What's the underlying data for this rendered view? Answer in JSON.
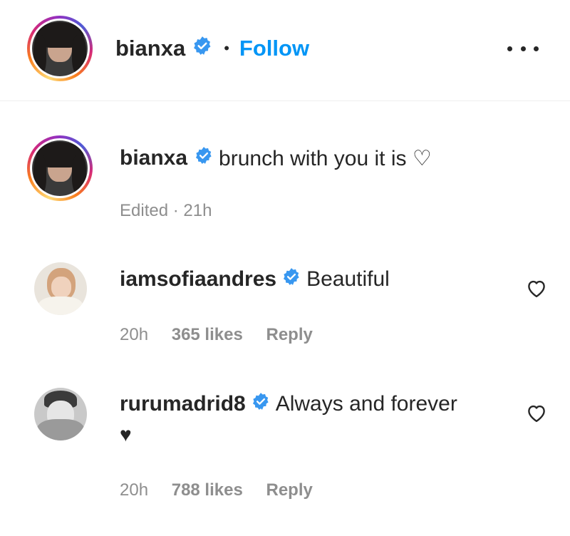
{
  "header": {
    "username": "bianxa",
    "separator": "•",
    "follow_label": "Follow",
    "more_label": "•••"
  },
  "caption": {
    "username": "bianxa",
    "text": "brunch with you it is ♡",
    "meta": "Edited · 21h"
  },
  "comments": [
    {
      "username": "iamsofiaandres",
      "text": "Beautiful",
      "time": "20h",
      "likes": "365 likes",
      "reply": "Reply"
    },
    {
      "username": "rurumadrid8",
      "text": "Always and forever",
      "text_line2": "♥",
      "time": "20h",
      "likes": "788 likes",
      "reply": "Reply"
    }
  ],
  "colors": {
    "verified": "#3897f0",
    "follow": "#0095f6",
    "muted": "#8e8e8e",
    "text": "#262626"
  }
}
